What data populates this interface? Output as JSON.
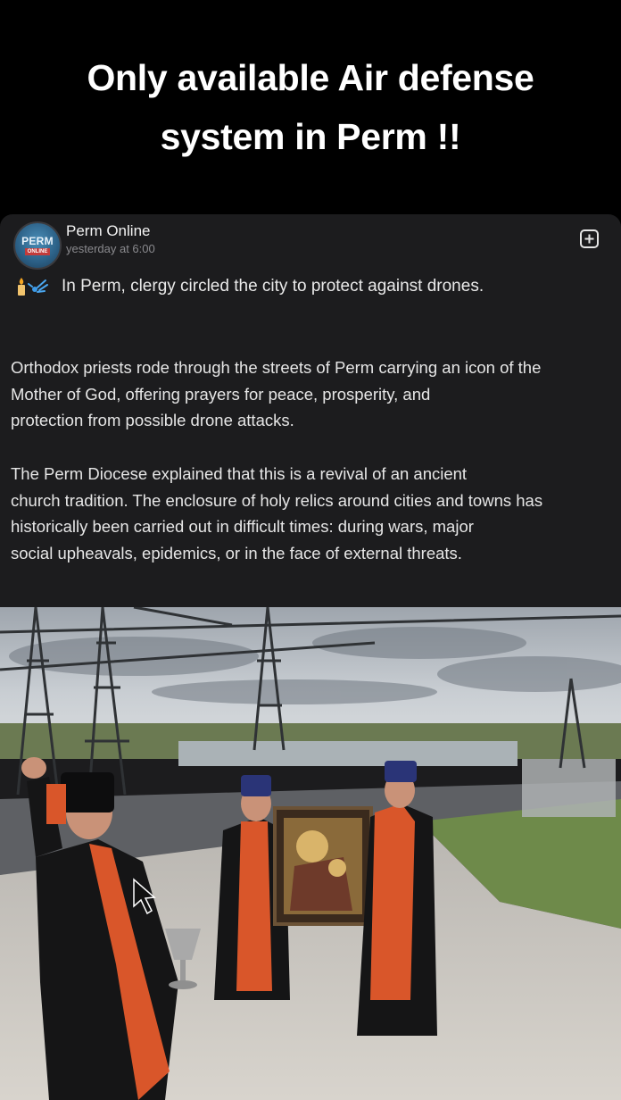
{
  "caption": {
    "line1": "Only available Air defense",
    "line2": "system in Perm !!"
  },
  "post": {
    "avatar": {
      "line1": "PERM",
      "line2": "ONLINE"
    },
    "page_name": "Perm Online",
    "timestamp": "yesterday at 6:00",
    "add_icon": "plus-square-icon",
    "lead_emoji": "candle-and-drone-emoji",
    "lead_text": "In Perm, clergy circled the city to protect against drones.",
    "paragraph1_lines": [
      "Orthodox priests rode through the streets of Perm carrying an icon of the",
      "Mother of God, offering prayers for peace, prosperity, and",
      "protection from possible drone attacks."
    ],
    "paragraph2_lines": [
      "The Perm Diocese explained that this is a revival of an ancient",
      "church tradition. The enclosure of holy relics around cities and towns has",
      "historically been carried out in difficult times: during wars, major",
      "social upheavals, epidemics, or in the face of external threats."
    ]
  },
  "colors": {
    "background": "#000000",
    "card": "#1c1c1e",
    "text": "#e6e6e6",
    "muted": "#8a8a8e",
    "vestment": "#d9562a"
  }
}
